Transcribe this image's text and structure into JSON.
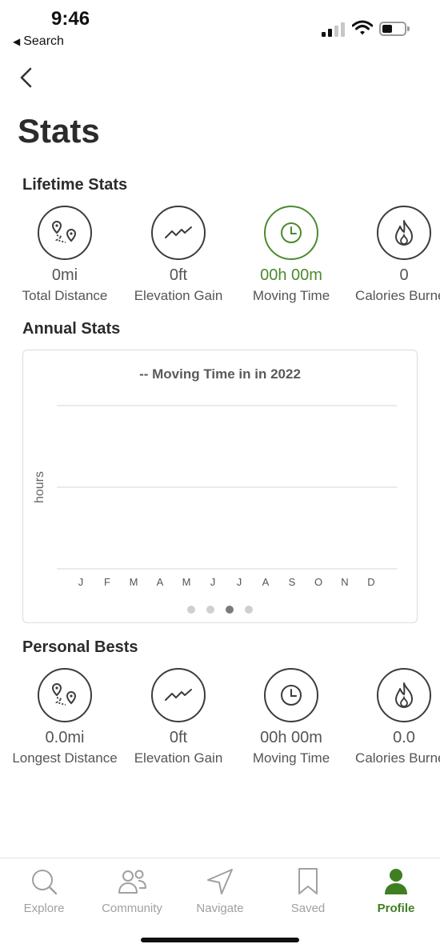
{
  "status_bar": {
    "time": "9:46",
    "back_label": "Search"
  },
  "page": {
    "title": "Stats"
  },
  "colors": {
    "accent": "#4b8a2e",
    "text": "#2b2b2b",
    "muted": "#555555",
    "inactive_tab": "#a0a0a0"
  },
  "lifetime": {
    "title": "Lifetime Stats",
    "items": [
      {
        "icon": "route-icon",
        "value": "0mi",
        "label": "Total Distance"
      },
      {
        "icon": "elevation-icon",
        "value": "0ft",
        "label": "Elevation Gain"
      },
      {
        "icon": "clock-icon",
        "value": "00h 00m",
        "label": "Moving Time",
        "active": true
      },
      {
        "icon": "flame-icon",
        "value": "0",
        "label": "Calories Burned"
      }
    ]
  },
  "annual": {
    "title": "Annual Stats",
    "chart_title": "-- Moving Time in in 2022",
    "page_dots": 4,
    "active_dot": 2
  },
  "chart_data": {
    "type": "bar",
    "title": "-- Moving Time in in 2022",
    "categories": [
      "J",
      "F",
      "M",
      "A",
      "M",
      "J",
      "J",
      "A",
      "S",
      "O",
      "N",
      "D"
    ],
    "values": [
      0,
      0,
      0,
      0,
      0,
      0,
      0,
      0,
      0,
      0,
      0,
      0
    ],
    "xlabel": "",
    "ylabel": "hours",
    "grid": true
  },
  "personal_bests": {
    "title": "Personal Bests",
    "items": [
      {
        "icon": "route-icon",
        "value": "0.0mi",
        "label": "Longest Distance"
      },
      {
        "icon": "elevation-icon",
        "value": "0ft",
        "label": "Elevation Gain"
      },
      {
        "icon": "clock-icon",
        "value": "00h 00m",
        "label": "Moving Time"
      },
      {
        "icon": "flame-icon",
        "value": "0.0",
        "label": "Calories Burned"
      }
    ]
  },
  "tabbar": {
    "tabs": [
      {
        "icon": "search-icon",
        "label": "Explore"
      },
      {
        "icon": "community-icon",
        "label": "Community"
      },
      {
        "icon": "navigate-icon",
        "label": "Navigate"
      },
      {
        "icon": "bookmark-icon",
        "label": "Saved"
      },
      {
        "icon": "profile-icon",
        "label": "Profile",
        "active": true
      }
    ]
  }
}
